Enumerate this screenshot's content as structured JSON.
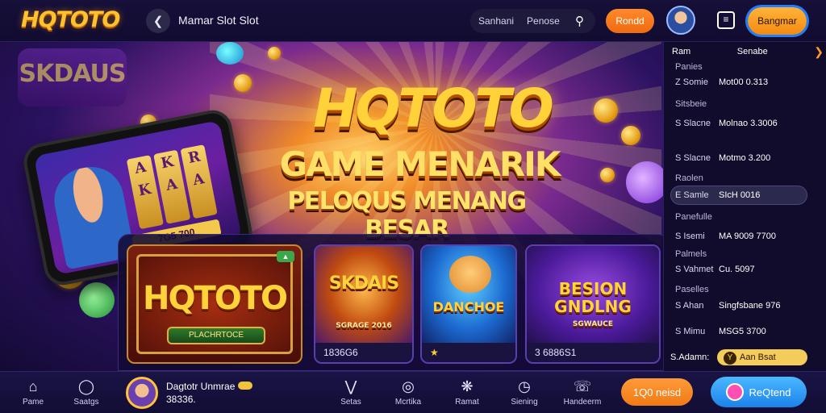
{
  "header": {
    "logo": "HQTOTO",
    "breadcrumb": "Mamar Slot Slot",
    "search": {
      "left_label": "Sanhani",
      "right_label": "Penose"
    },
    "primary_button": "Rondd",
    "login_button": "Bangmar"
  },
  "hero": {
    "bg_sign": "SKDAUS",
    "title": "HQTOTO",
    "subtitle_1": "GAME MENARIK",
    "subtitle_2": "PELOQUS MENANG BESAR",
    "phone_amount": "7G5 700"
  },
  "games": [
    {
      "title": "HQTOTO",
      "subtitle": "PLACHRTOCE",
      "meta": ""
    },
    {
      "title": "SKDAIS",
      "subtitle": "SGRAGE 2016",
      "meta": "1836G6"
    },
    {
      "title": "DANCHOE",
      "subtitle": "",
      "meta": ""
    },
    {
      "title": "BESION GNDLNG",
      "subtitle": "SGWAUCE",
      "meta": "3 6886S1"
    }
  ],
  "sidebar": {
    "head_left": "Ram",
    "head_right": "Senabe",
    "rows": [
      {
        "col1": "Panies",
        "col2": ""
      },
      {
        "col1": "Z Somie",
        "col2": "Mot00 0.313"
      },
      {
        "col1": "Sitsbeie",
        "col2": ""
      },
      {
        "col1": "S Slacne",
        "col2": "Molnao 3.3006"
      },
      {
        "col1": "S Slacne",
        "col2": "Motmo 3.200"
      },
      {
        "col1": "Raolen",
        "col2": ""
      },
      {
        "col1": "E Samle",
        "col2": "SIcH 0016"
      },
      {
        "col1": "Panefulle",
        "col2": ""
      },
      {
        "col1": "S Isemi",
        "col2": "MA 9009 7700"
      },
      {
        "col1": "Palmels",
        "col2": ""
      },
      {
        "col1": "S Vahmet",
        "col2": "Cu. 5097"
      },
      {
        "col1": "Paselles",
        "col2": ""
      },
      {
        "col1": "S Ahan",
        "col2": "Singfsbane 976"
      },
      {
        "col1": "S Mimu",
        "col2": "MSG5 3700"
      }
    ],
    "bottom_label": "S.Adamn:",
    "bottom_value": "Aan Bsat"
  },
  "bottomnav": {
    "items": [
      "Pame",
      "Saatgs",
      "Setas",
      "Mcrtika",
      "Ramat",
      "Siening",
      "Handeerm"
    ],
    "user_name": "Dagtotr Unmrae",
    "user_balance": "38336.",
    "pill_orange": "1Q0 neisd",
    "pill_blue": "ReQtend"
  }
}
